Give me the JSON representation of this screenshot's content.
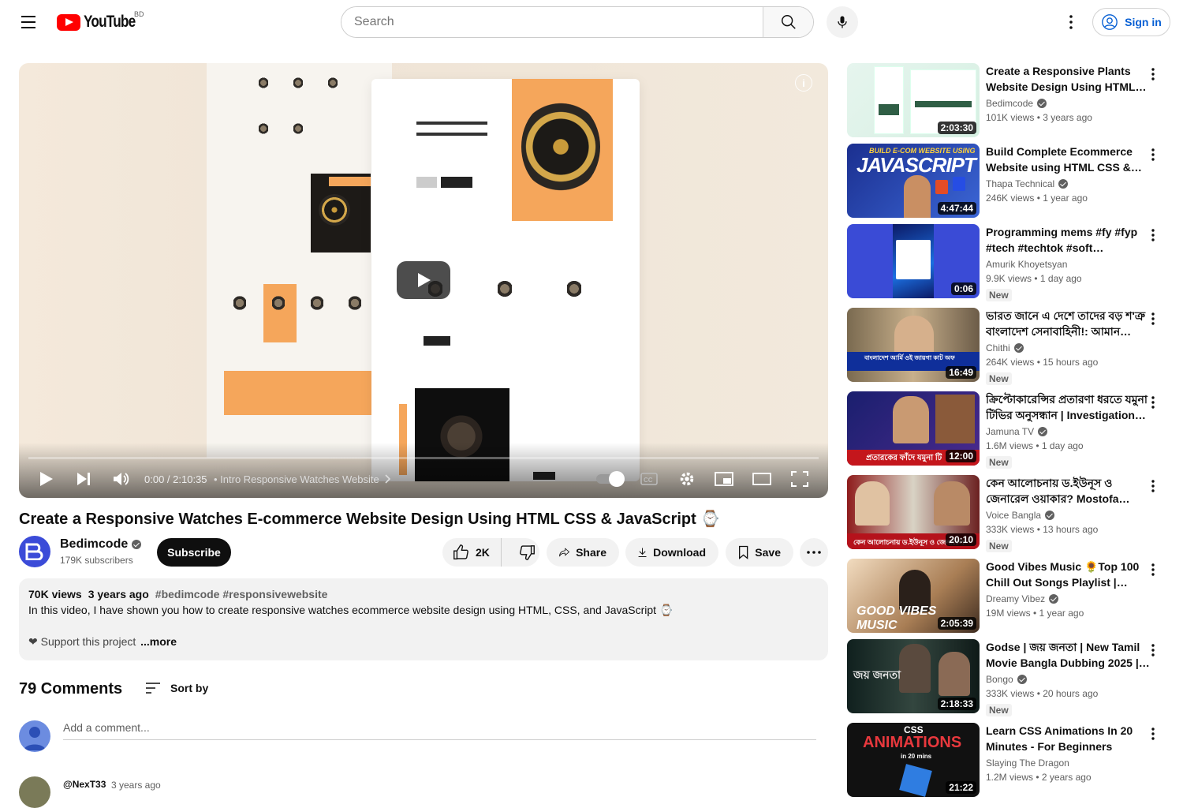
{
  "header": {
    "logo_text": "YouTube",
    "country_code": "BD",
    "search_placeholder": "Search",
    "sign_in_label": "Sign in"
  },
  "player": {
    "time": "0:00 / 2:10:35",
    "chapter": "Intro Responsive Watches Website",
    "progress": 0
  },
  "video": {
    "title": "Create a Responsive Watches E-commerce Website Design Using HTML CSS & JavaScript ⌚",
    "channel": "Bedimcode",
    "subscribers": "179K subscribers",
    "subscribe_label": "Subscribe",
    "likes": "2K",
    "share_label": "Share",
    "download_label": "Download",
    "save_label": "Save"
  },
  "description": {
    "views": "70K views",
    "date": "3 years ago",
    "tags": "#bedimcode #responsivewebsite",
    "line1": "In this video, I have shown you how to create responsive watches ecommerce website design using HTML, CSS, and JavaScript ⌚",
    "line2": "❤ Support this project",
    "more": "...more"
  },
  "comments": {
    "count": "79 Comments",
    "sort_label": "Sort by",
    "add_placeholder": "Add a comment...",
    "first_author": "@NexT33",
    "first_time": "3 years ago"
  },
  "recommendations": [
    {
      "title": "Create a Responsive Plants Website Design Using HTML…",
      "channel": "Bedimcode",
      "verified": true,
      "stats": "101K views  •  3 years ago",
      "duration": "2:03:30",
      "new": ""
    },
    {
      "title": "Build Complete Ecommerce Website using HTML CSS &…",
      "channel": "Thapa Technical",
      "verified": true,
      "stats": "246K views  •  1 year ago",
      "duration": "4:47:44",
      "new": ""
    },
    {
      "title": "Programming mems #fy #fyp #tech #techtok #soft #softwar…",
      "channel": "Amurik Khoyetsyan",
      "verified": false,
      "stats": "9.9K views  •  1 day ago",
      "duration": "0:06",
      "new": "New"
    },
    {
      "title": "ভারত জানে এ দেশে তাদের বড় শ'ত্রু বাংলাদেশ সেনাবাহিনী!: আমান…",
      "channel": "Chithi",
      "verified": true,
      "stats": "264K views  •  15 hours ago",
      "duration": "16:49",
      "new": "New"
    },
    {
      "title": "ক্রিপ্টোকারেন্সির প্রতারণা ধরতে যমুনা টিভির অনুসন্ধান | Investigation…",
      "channel": "Jamuna TV",
      "verified": true,
      "stats": "1.6M views  •  1 day ago",
      "duration": "12:00",
      "new": "New"
    },
    {
      "title": "কেন আলোচনায় ড.ইউনূস ও জেনারেল ওয়াকার? Mostofa Fero…",
      "channel": "Voice Bangla",
      "verified": true,
      "stats": "333K views  •  13 hours ago",
      "duration": "20:10",
      "new": "New"
    },
    {
      "title": "Good Vibes Music 🌻Top 100 Chill Out Songs Playlist | New…",
      "channel": "Dreamy Vibez",
      "verified": true,
      "stats": "19M views  •  1 year ago",
      "duration": "2:05:39",
      "new": ""
    },
    {
      "title": "Godse | জয় জনতা | New Tamil Movie Bangla Dubbing 2025 |…",
      "channel": "Bongo",
      "verified": true,
      "stats": "333K views  •  20 hours ago",
      "duration": "2:18:33",
      "new": "New"
    },
    {
      "title": "Learn CSS Animations In 20 Minutes - For Beginners",
      "channel": "Slaying The Dragon",
      "verified": false,
      "stats": "1.2M views  •  2 years ago",
      "duration": "21:22",
      "new": ""
    }
  ],
  "thumb_text": {
    "js_top": "BUILD E-COM WEBSITE USING",
    "js_main": "JAVASCRIPT",
    "goodvibes": "GOOD VIBES MUSIC",
    "godse": "জয় জনতা",
    "css_top": "CSS",
    "css_main": "ANIMATIONS",
    "css_sub": "in 20 mins",
    "bn_caption1": "বাংলাদেশ আর্মি ওই জায়গা কাট অফ",
    "bn_caption2": "প্রতারকের ফাঁদে যমুনা টি",
    "bn_caption3": "কেন আলোচনায় ড.ইউনূস ও জেনারেল"
  },
  "colors": {
    "brand_red": "#ff0000",
    "link_blue": "#065fd4",
    "chip_bg": "#f2f2f2"
  }
}
